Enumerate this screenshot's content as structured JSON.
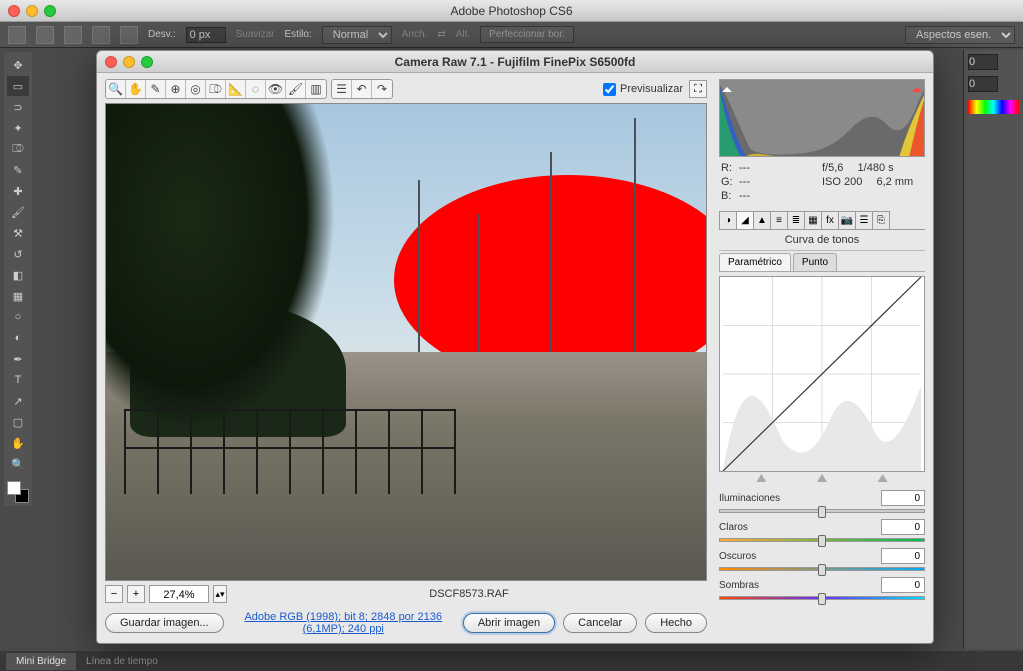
{
  "photoshop": {
    "title": "Adobe Photoshop CS6",
    "options": {
      "desv_label": "Desv.:",
      "desv_value": "0 px",
      "suavizar": "Suavizar",
      "estilo_label": "Estilo:",
      "estilo_value": "Normal",
      "anch": "Anch.",
      "alt": "Alt.",
      "perfeccionar": "Perfeccionar bor.",
      "workspace": "Aspectos esen."
    },
    "right_fields": {
      "x": "0",
      "y": "0"
    },
    "bottom_tabs": {
      "mini_bridge": "Mini Bridge",
      "timeline": "Línea de tiempo"
    }
  },
  "camera_raw": {
    "title": "Camera Raw 7.1  -  Fujifilm FinePix S6500fd",
    "preview_label": "Previsualizar",
    "zoom_value": "27,4%",
    "filename": "DSCF8573.RAF",
    "link_text": "Adobe RGB (1998); bit 8; 2848 por 2136 (6,1MP); 240 ppi",
    "buttons": {
      "save_image": "Guardar imagen...",
      "open": "Abrir imagen",
      "cancel": "Cancelar",
      "done": "Hecho"
    },
    "info": {
      "r": "R:",
      "g": "G:",
      "b": "B:",
      "r_val": "---",
      "g_val": "---",
      "b_val": "---",
      "aperture": "f/5,6",
      "shutter": "1/480 s",
      "iso": "ISO 200",
      "focal": "6,2 mm"
    },
    "panel_title": "Curva de tonos",
    "subtabs": {
      "parametric": "Paramétrico",
      "point": "Punto"
    },
    "sliders": {
      "iluminaciones": {
        "label": "Iluminaciones",
        "value": "0"
      },
      "claros": {
        "label": "Claros",
        "value": "0"
      },
      "oscuros": {
        "label": "Oscuros",
        "value": "0"
      },
      "sombras": {
        "label": "Sombras",
        "value": "0"
      }
    }
  }
}
